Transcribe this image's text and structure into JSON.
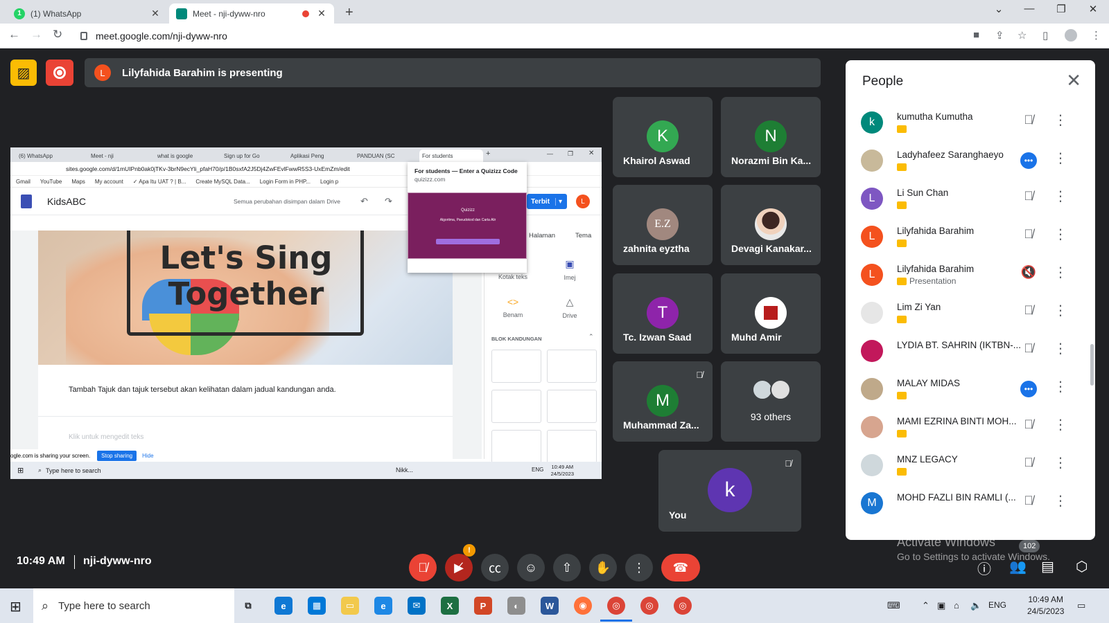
{
  "browser": {
    "tabs": [
      {
        "title": "(1) WhatsApp",
        "badge": "1",
        "active": false
      },
      {
        "title": "Meet - nji-dyww-nro",
        "active": true
      }
    ],
    "url": "meet.google.com/nji-dyww-nro"
  },
  "meet": {
    "presenting_initial": "L",
    "presenting_text": "Lilyfahida Barahim is presenting",
    "time": "10:49 AM",
    "meeting_code": "nji-dyww-nro"
  },
  "shared_screen": {
    "tabs": [
      "(6) WhatsApp",
      "Meet - nji",
      "what is google",
      "Sign up for Go",
      "Aplikasi Peng",
      "PANDUAN (SC",
      "For students"
    ],
    "url": "sites.google.com/d/1mUIPnb0ak0jTKv-3brN9ecYli_pfaH70/p/1B0sxfA2J5Dj4ZwFEvlFwwR5S3-UxEmZm/edit",
    "bookmarks": [
      "Gmail",
      "YouTube",
      "Maps",
      "My account",
      "✓ Apa Itu UAT ? | B...",
      "Create MySQL Data...",
      "Login Form in PHP...",
      "Login p"
    ],
    "site_name": "KidsABC",
    "saved_text": "Semua perubahan disimpan dalam Drive",
    "publish_label": "Terbit",
    "user_initial": "L",
    "hero_title_1": "Let's Sing",
    "hero_title_2": "Together",
    "body_text": "Tambah Tajuk dan tajuk tersebut akan kelihatan dalam jadual kandungan anda.",
    "body_placeholder": "Klik untuk mengedit teks",
    "panel_tabs": [
      "Halaman",
      "Tema"
    ],
    "insert_items": [
      {
        "label": "Kotak teks",
        "icon": "Tт"
      },
      {
        "label": "Imej",
        "icon": "▣"
      },
      {
        "label": "Benam",
        "icon": "<>"
      },
      {
        "label": "Drive",
        "icon": "△"
      }
    ],
    "content_blocks_label": "BLOK KANDUNGAN",
    "popup_title": "For students — Enter a Quizizz Code",
    "popup_url": "quizizz.com",
    "popup_thumb_title": "Quizizz",
    "popup_thumb_subtitle": "Algoritma, Pseudokod dan Carta Alir",
    "sharing_text": "ogle.com is sharing your screen.",
    "stop_sharing": "Stop sharing",
    "hide": "Hide",
    "taskbar_search": "Type here to search",
    "taskbar_app": "Nikk...",
    "taskbar_lang": "ENG",
    "taskbar_time": "10:49 AM",
    "taskbar_date": "24/5/2023"
  },
  "tiles": [
    {
      "name": "Khairol Aswad",
      "initial": "K",
      "color": "#33a852"
    },
    {
      "name": "Norazmi Bin Ka...",
      "initial": "N",
      "color": "#1e7e34"
    },
    {
      "name": "zahnita eyztha",
      "initial": "E.Z",
      "color": "#a1887f"
    },
    {
      "name": "Devagi Kanakar...",
      "initial": "",
      "color": "#e0e0e0"
    },
    {
      "name": "Tc. Izwan Saad",
      "initial": "T",
      "color": "#8e24aa"
    },
    {
      "name": "Muhd Amir",
      "initial": "",
      "color": "#ffffff"
    },
    {
      "name": "Muhammad Za...",
      "initial": "M",
      "color": "#1e7e34"
    },
    {
      "name": "93 others",
      "initial": "",
      "color": ""
    },
    {
      "name": "You",
      "initial": "k",
      "color": "#5e35b1"
    }
  ],
  "people": {
    "title": "People",
    "list": [
      {
        "name": "kumutha Kumutha",
        "initial": "k",
        "color": "#00897b",
        "state": "muted",
        "sub": ""
      },
      {
        "name": "Ladyhafeez Saranghaeyo",
        "initial": "",
        "color": "#c8b99a",
        "state": "speaking",
        "sub": ""
      },
      {
        "name": "Li Sun Chan",
        "initial": "L",
        "color": "#7e57c2",
        "state": "muted",
        "sub": ""
      },
      {
        "name": "Lilyfahida Barahim",
        "initial": "L",
        "color": "#f4511e",
        "state": "muted",
        "sub": ""
      },
      {
        "name": "Lilyfahida Barahim",
        "initial": "L",
        "color": "#f4511e",
        "state": "sound-off",
        "sub": "Presentation"
      },
      {
        "name": "Lim Zi Yan",
        "initial": "",
        "color": "#e6e6e6",
        "state": "muted",
        "sub": ""
      },
      {
        "name": "LYDIA BT. SAHRIN (IKTBN-...",
        "initial": "",
        "color": "#c2185b",
        "state": "muted",
        "sub": ""
      },
      {
        "name": "MALAY MIDAS",
        "initial": "",
        "color": "#bfa98a",
        "state": "speaking",
        "sub": ""
      },
      {
        "name": "MAMI EZRINA BINTI MOH...",
        "initial": "",
        "color": "#d7a58f",
        "state": "muted",
        "sub": ""
      },
      {
        "name": "MNZ LEGACY",
        "initial": "",
        "color": "#cfd8dc",
        "state": "muted",
        "sub": ""
      },
      {
        "name": "MOHD FAZLI BIN RAMLI (...",
        "initial": "M",
        "color": "#1976d2",
        "state": "muted",
        "sub": ""
      }
    ]
  },
  "controls": {
    "people_count": "102",
    "warning": "!",
    "activate_title": "Activate Windows",
    "activate_sub": "Go to Settings to activate Windows."
  },
  "taskbar": {
    "search": "Type here to search",
    "lang": "ENG",
    "time": "10:49 AM",
    "date": "24/5/2023"
  },
  "colors": {
    "meet_bg": "#202124",
    "tile_bg": "#3c4043",
    "accent": "#1a73e8",
    "end_call": "#ea4335",
    "warning": "#fbbc04"
  }
}
